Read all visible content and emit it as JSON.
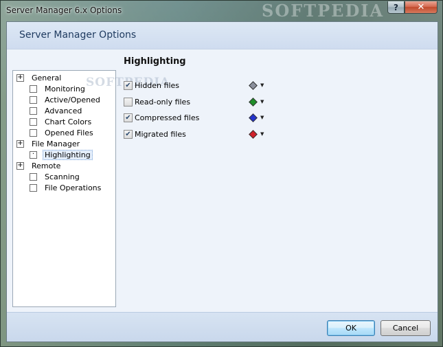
{
  "window": {
    "title": "Server Manager 6.x Options",
    "watermark": "SOFTPEDIA",
    "help_label": "?",
    "close_label": "✕"
  },
  "header": {
    "title": "Server Manager Options"
  },
  "tree": {
    "items": [
      {
        "label": "General",
        "level": 0,
        "toggle": "+"
      },
      {
        "label": "Monitoring",
        "level": 1,
        "toggle": ""
      },
      {
        "label": "Active/Opened",
        "level": 1,
        "toggle": ""
      },
      {
        "label": "Advanced",
        "level": 1,
        "toggle": ""
      },
      {
        "label": "Chart Colors",
        "level": 1,
        "toggle": ""
      },
      {
        "label": "Opened Files",
        "level": 1,
        "toggle": ""
      },
      {
        "label": "File Manager",
        "level": 0,
        "toggle": "+"
      },
      {
        "label": "Highlighting",
        "level": 1,
        "toggle": "·",
        "selected": true
      },
      {
        "label": "Remote",
        "level": 0,
        "toggle": "+"
      },
      {
        "label": "Scanning",
        "level": 1,
        "toggle": ""
      },
      {
        "label": "File Operations",
        "level": 1,
        "toggle": ""
      }
    ]
  },
  "content": {
    "section_title": "Highlighting",
    "watermark": "SOFTPEDIA",
    "options": [
      {
        "label": "Hidden files",
        "checked": true,
        "color": "#8a8f9c",
        "color_name": "gray"
      },
      {
        "label": "Read-only files",
        "checked": false,
        "color": "#1f8f2a",
        "color_name": "green"
      },
      {
        "label": "Compressed files",
        "checked": true,
        "color": "#2233cc",
        "color_name": "blue"
      },
      {
        "label": "Migrated files",
        "checked": true,
        "color": "#d0202a",
        "color_name": "red"
      }
    ],
    "dropdown_caret": "▼"
  },
  "footer": {
    "ok_label": "OK",
    "cancel_label": "Cancel"
  }
}
